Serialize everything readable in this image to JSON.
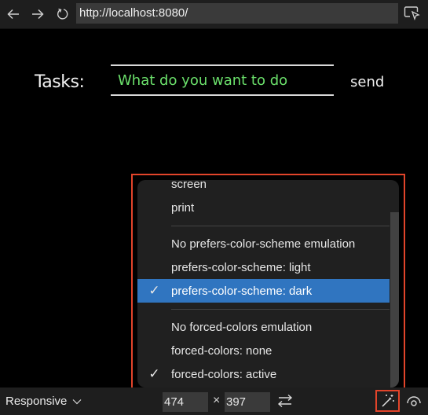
{
  "browser": {
    "back_icon": "arrow-left-icon",
    "forward_icon": "arrow-right-icon",
    "reload_icon": "reload-icon",
    "url": "http://localhost:8080/",
    "inspect_icon": "inspect-element-icon"
  },
  "page": {
    "label": "Tasks:",
    "input_placeholder": "What do you want to do",
    "send_label": "send"
  },
  "menu": {
    "groups": [
      {
        "items": [
          {
            "label": "screen",
            "checked": false,
            "selected": false
          },
          {
            "label": "print",
            "checked": false,
            "selected": false
          }
        ]
      },
      {
        "items": [
          {
            "label": "No prefers-color-scheme emulation",
            "checked": false,
            "selected": false
          },
          {
            "label": "prefers-color-scheme: light",
            "checked": false,
            "selected": false
          },
          {
            "label": "prefers-color-scheme: dark",
            "checked": true,
            "selected": true
          }
        ]
      },
      {
        "items": [
          {
            "label": "No forced-colors emulation",
            "checked": false,
            "selected": false
          },
          {
            "label": "forced-colors: none",
            "checked": false,
            "selected": false
          },
          {
            "label": "forced-colors: active",
            "checked": true,
            "selected": false
          }
        ]
      }
    ],
    "check_glyph": "✓"
  },
  "toolbar": {
    "device_label": "Responsive",
    "width": "474",
    "height": "397",
    "times_glyph": "×",
    "swap_icon": "rotate-swap-icon",
    "emulate_icon": "magic-wand-icon",
    "vision_icon": "eye-icon"
  },
  "colors": {
    "accent_highlight": "#e2442a",
    "selection": "#3075c0",
    "input_text": "#6be06b"
  }
}
